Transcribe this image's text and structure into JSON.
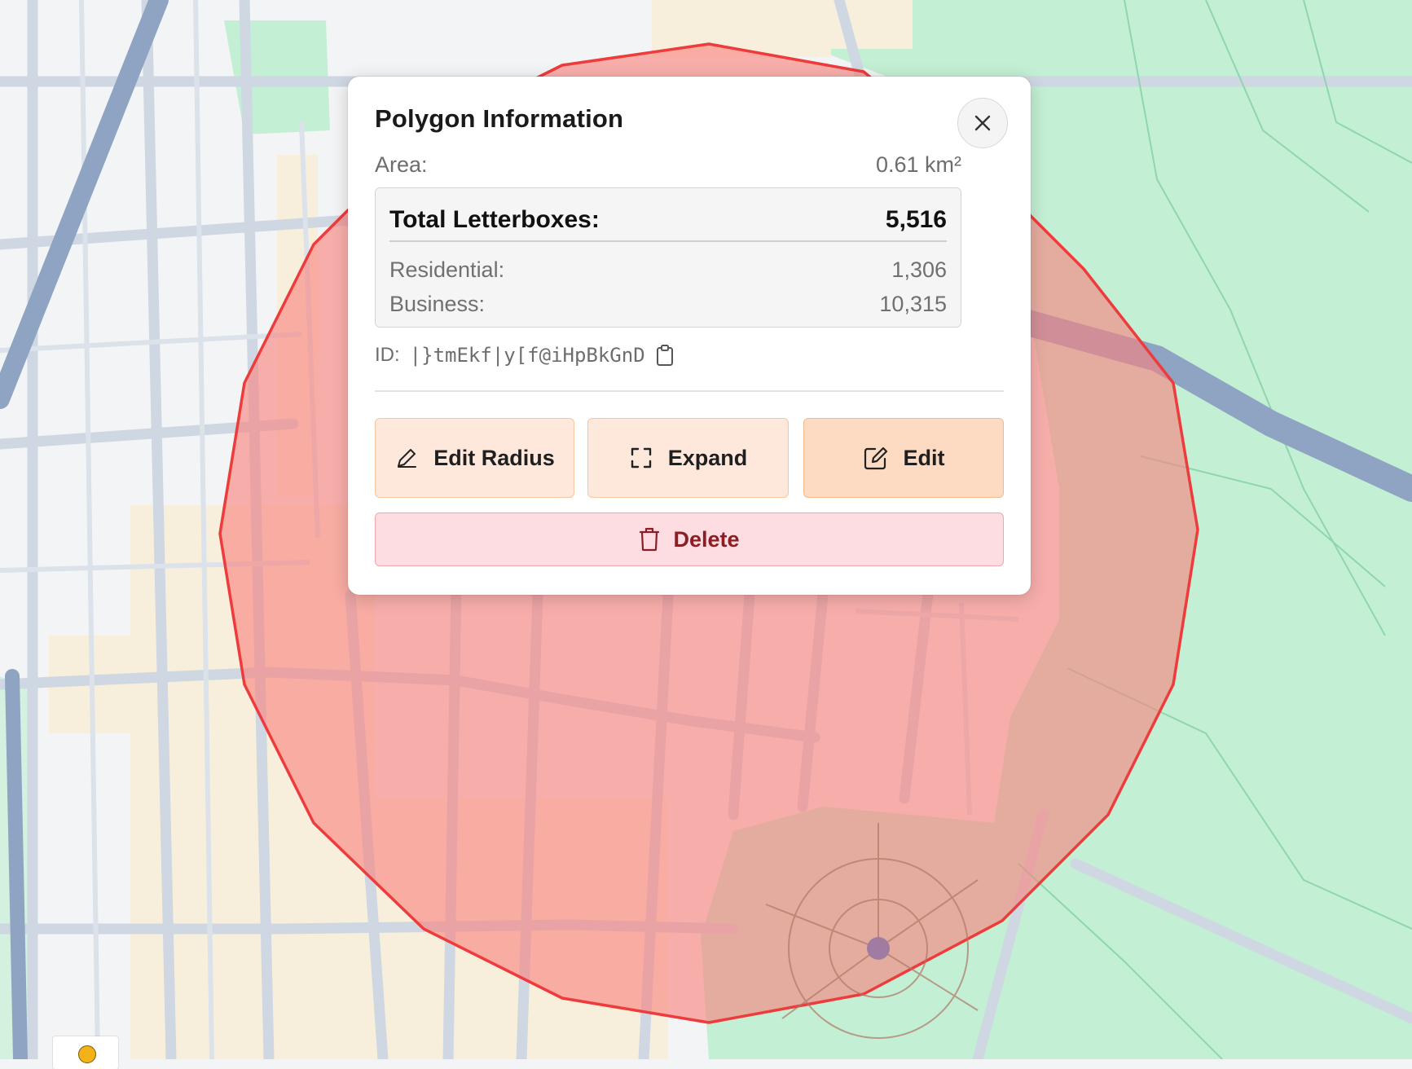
{
  "popup": {
    "title": "Polygon Information",
    "area_label": "Area:",
    "area_value": "0.61 km²",
    "total_label": "Total Letterboxes:",
    "total_value": "5,516",
    "residential_label": "Residential:",
    "residential_value": "1,306",
    "business_label": "Business:",
    "business_value": "10,315",
    "id_label": "ID:",
    "id_value": "|}tmEkf|y[f@iHpBkGnD"
  },
  "actions": {
    "edit_radius_label": "Edit Radius",
    "expand_label": "Expand",
    "edit_label": "Edit",
    "delete_label": "Delete"
  },
  "icons": {
    "close": "close-icon",
    "copy": "clipboard-icon",
    "edit_radius": "pencil-icon",
    "expand": "expand-icon",
    "edit": "edit-square-icon",
    "delete": "trash-icon"
  },
  "colors": {
    "polygon_fill": "#f9837e",
    "polygon_stroke": "#ee3b3b",
    "park_green": "#c3efd4",
    "road_blue_gray": "#b7c4d6",
    "highway": "#8fa4c2",
    "action_button": "#fde8db",
    "delete_button": "#fedde2",
    "delete_text": "#8c1d24"
  }
}
